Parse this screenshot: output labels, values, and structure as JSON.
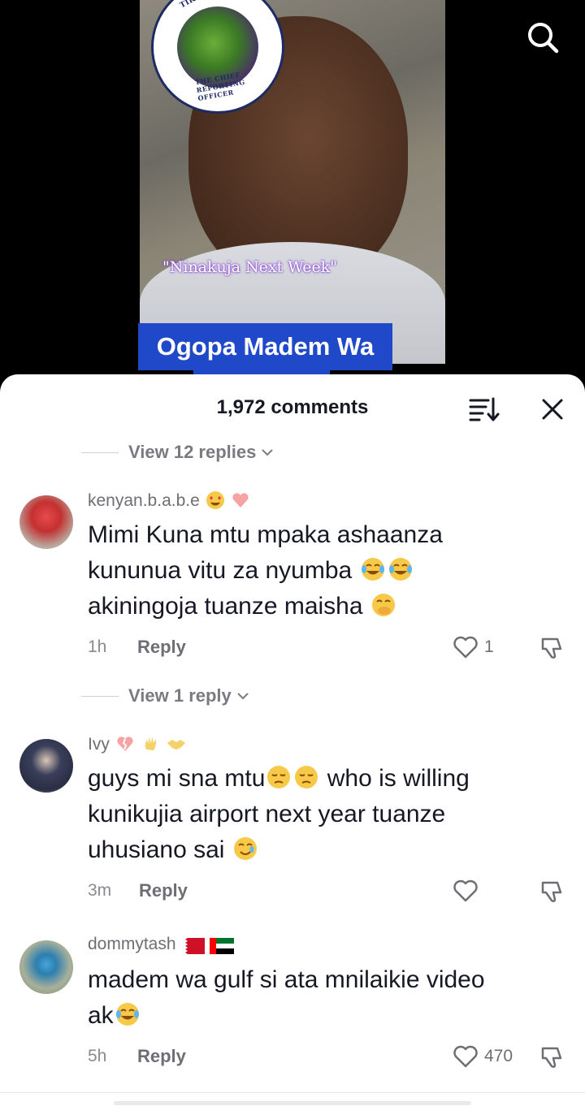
{
  "video": {
    "badge_top_text": "TIKTOKTR",
    "badge_bottom_text": "THE CHIEF REPORTING OFFICER",
    "quote": "\"Ninakuja Next Week\"",
    "caption": "Ogopa Madem Wa"
  },
  "sheet": {
    "comments_count": "1,972 comments"
  },
  "replies": [
    {
      "label": "View 12 replies"
    },
    {
      "label": "View 1 reply"
    }
  ],
  "comments": [
    {
      "username": "kenyan.b.a.b.e",
      "text_lines": [
        "Mimi Kuna mtu mpaka ashaanza",
        "kununua vitu za nyumba",
        "akiningoja tuanze maisha"
      ],
      "time": "1h",
      "reply_label": "Reply",
      "likes": "1"
    },
    {
      "username": "Ivy",
      "text_lines": [
        "guys mi sna mtu",
        " who is willing",
        "kunikujia airport next year tuanze",
        "uhusiano sai"
      ],
      "time": "3m",
      "reply_label": "Reply",
      "likes": ""
    },
    {
      "username": "dommytash",
      "text_lines": [
        "madem wa gulf si ata mnilaikie video",
        "ak"
      ],
      "time": "5h",
      "reply_label": "Reply",
      "likes": "470"
    }
  ],
  "colors": {
    "caption_bg": "#1f49c8",
    "text_primary": "#161823",
    "text_secondary": "#6e6e75"
  }
}
